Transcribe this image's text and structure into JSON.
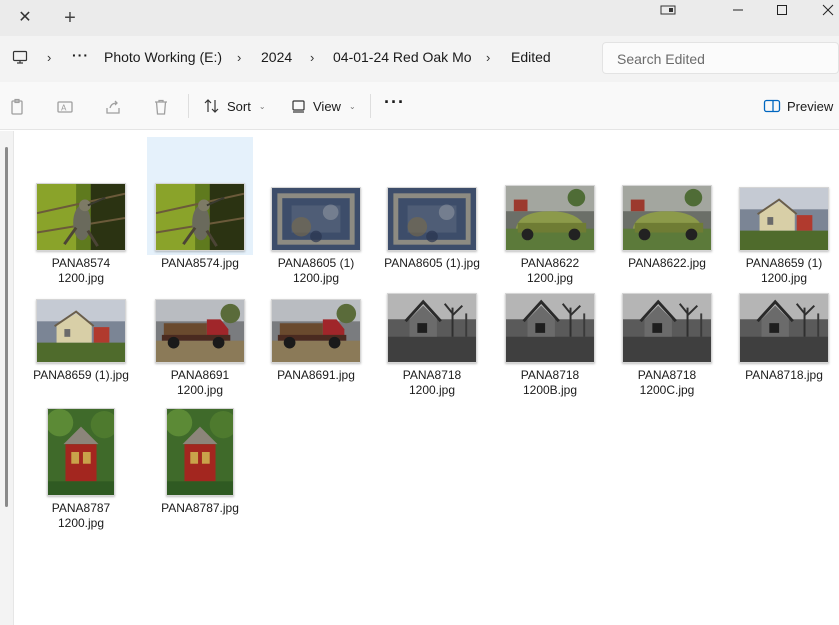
{
  "titlebar": {
    "close_tab_glyph": "✕",
    "new_tab_glyph": "+"
  },
  "address": {
    "crumbs": [
      "Photo Working (E:)",
      "2024",
      "04-01-24 Red Oak Mo",
      "Edited"
    ],
    "more_glyph": "···",
    "sep_glyph": "›"
  },
  "search": {
    "placeholder": "Search Edited"
  },
  "commands": {
    "sort_label": "Sort",
    "view_label": "View",
    "more_glyph": "···",
    "preview_label": "Preview",
    "chevron_glyph": "⌄"
  },
  "files": [
    {
      "line1": "PANA8574",
      "line2": "1200.jpg",
      "thumb": "hummingbird",
      "selected": false
    },
    {
      "line1": "PANA8574.jpg",
      "line2": "",
      "thumb": "hummingbird",
      "selected": true
    },
    {
      "line1": "PANA8605 (1)",
      "line2": "1200.jpg",
      "thumb": "texture",
      "selected": false
    },
    {
      "line1": "PANA8605 (1).jpg",
      "line2": "",
      "thumb": "texture",
      "selected": false
    },
    {
      "line1": "PANA8622",
      "line2": "1200.jpg",
      "thumb": "green-car",
      "selected": false
    },
    {
      "line1": "PANA8622.jpg",
      "line2": "",
      "thumb": "green-car",
      "selected": false
    },
    {
      "line1": "PANA8659 (1)",
      "line2": "1200.jpg",
      "thumb": "shed",
      "selected": false
    },
    {
      "line1": "PANA8659 (1).jpg",
      "line2": "",
      "thumb": "shed",
      "selected": false
    },
    {
      "line1": "PANA8691",
      "line2": "1200.jpg",
      "thumb": "truck",
      "selected": false
    },
    {
      "line1": "PANA8691.jpg",
      "line2": "",
      "thumb": "truck",
      "selected": false
    },
    {
      "line1": "PANA8718",
      "line2": "1200.jpg",
      "thumb": "bw-house",
      "selected": false
    },
    {
      "line1": "PANA8718",
      "line2": "1200B.jpg",
      "thumb": "bw-house",
      "selected": false
    },
    {
      "line1": "PANA8718",
      "line2": "1200C.jpg",
      "thumb": "bw-house",
      "selected": false
    },
    {
      "line1": "PANA8718.jpg",
      "line2": "",
      "thumb": "bw-house",
      "selected": false
    },
    {
      "line1": "PANA8787",
      "line2": "1200.jpg",
      "thumb": "red-house",
      "selected": false
    },
    {
      "line1": "PANA8787.jpg",
      "line2": "",
      "thumb": "red-house",
      "selected": false
    }
  ],
  "colors": {
    "selection": "#e5f1fb",
    "titlebar": "#ebebeb",
    "accent": "#0067c0"
  }
}
